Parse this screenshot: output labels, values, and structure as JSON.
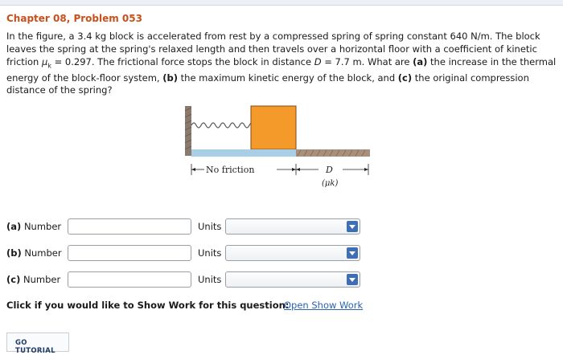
{
  "header": {
    "title": "Chapter 08, Problem 053"
  },
  "problem": {
    "seg1": "In the figure, a 3.4 kg block is accelerated from rest by a compressed spring of spring constant 640 N/m. The block leaves the spring at the spring's relaxed length and then travels over a horizontal floor with a coefficient of kinetic friction ",
    "mu": "μ",
    "mu_sub": "k",
    "seg2": " = 0.297. The frictional force stops the block in distance ",
    "D": "D",
    "seg3": " = 7.7 m. What are ",
    "a_tag": "(a)",
    "seg4": " the increase in the thermal energy of the block-floor system, ",
    "b_tag": "(b)",
    "seg5": " the maximum kinetic energy of the block, and ",
    "c_tag": "(c)",
    "seg6": " the original compression distance of the spring?"
  },
  "figure": {
    "no_friction_label": "No friction",
    "d_label": "D",
    "mu_label": "(μk)"
  },
  "answers": [
    {
      "tag": "(a)",
      "label": "Number",
      "units_label": "Units",
      "value": "",
      "units_value": ""
    },
    {
      "tag": "(b)",
      "label": "Number",
      "units_label": "Units",
      "value": "",
      "units_value": ""
    },
    {
      "tag": "(c)",
      "label": "Number",
      "units_label": "Units",
      "value": "",
      "units_value": ""
    }
  ],
  "show_work": {
    "prompt": "Click if you would like to Show Work for this question:",
    "link": "Open Show Work"
  },
  "tutorial": {
    "button": "GO TUTORIAL"
  },
  "colors": {
    "title": "#c7501b",
    "block": "#f39a2a",
    "frictionless_floor": "#a9cfe8",
    "link": "#2a63b0",
    "select_caret": "#3d6fb6"
  }
}
